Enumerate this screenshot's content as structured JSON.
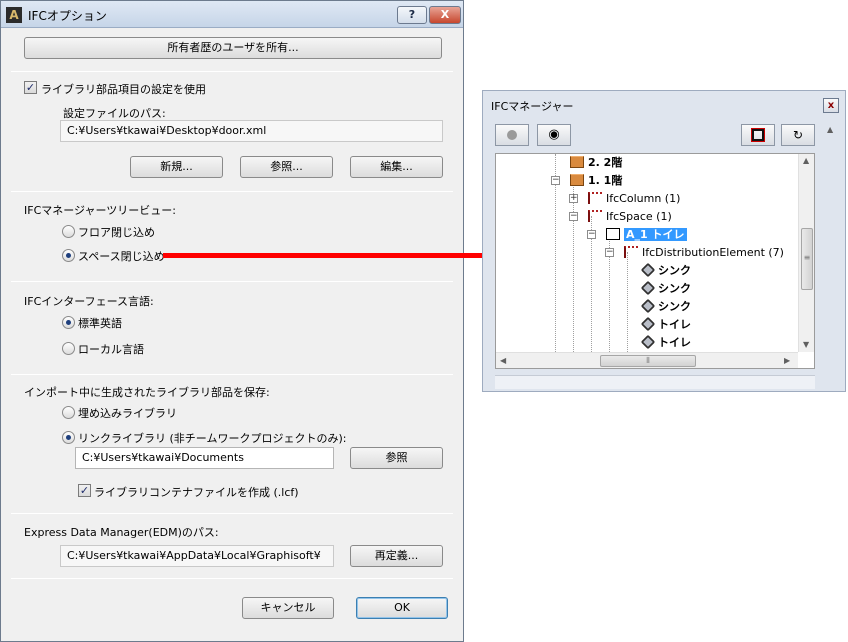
{
  "dialog": {
    "title": "IFCオプション",
    "help_label": "?",
    "close_label": "X",
    "owner_button": "所有者歴のユーザを所有...",
    "library": {
      "checkbox_label": "ライブラリ部品項目の設定を使用",
      "checked": true,
      "path_label": "設定ファイルのパス:",
      "path_value": "C:¥Users¥tkawai¥Desktop¥door.xml",
      "new_button": "新規...",
      "browse_button": "参照...",
      "edit_button": "編集..."
    },
    "tree_view": {
      "label": "IFCマネージャーツリービュー:",
      "options": [
        "フロア閉じ込め",
        "スペース閉じ込め"
      ],
      "selected": "スペース閉じ込め"
    },
    "language": {
      "label": "IFCインターフェース言語:",
      "options": [
        "標準英語",
        "ローカル言語"
      ],
      "selected": "標準英語"
    },
    "import_save": {
      "label": "インポート中に生成されたライブラリ部品を保存:",
      "options": [
        "埋め込みライブラリ",
        "リンクライブラリ (非チームワークプロジェクトのみ):"
      ],
      "selected": "リンクライブラリ (非チームワークプロジェクトのみ):",
      "path_value": "C:¥Users¥tkawai¥Documents",
      "browse_button": "参照",
      "container_label": "ライブラリコンテナファイルを作成 (.lcf)",
      "container_checked": true
    },
    "edm": {
      "label": "Express Data Manager(EDM)のパス:",
      "path_value": "C:¥Users¥tkawai¥AppData¥Local¥Graphisoft¥",
      "redefine_button": "再定義..."
    },
    "cancel_button": "キャンセル",
    "ok_button": "OK"
  },
  "ifc_manager": {
    "title": "IFCマネージャー",
    "close_label": "x",
    "tree": [
      {
        "label": "2. 2階"
      },
      {
        "label": "1. 1階"
      },
      {
        "label": "IfcColumn (1)"
      },
      {
        "label": "IfcSpace (1)"
      },
      {
        "label": "A_1 トイレ"
      },
      {
        "label": "IfcDistributionElement (7)"
      },
      {
        "label": "シンク"
      },
      {
        "label": "シンク"
      },
      {
        "label": "シンク"
      },
      {
        "label": "トイレ"
      },
      {
        "label": "トイレ"
      }
    ]
  },
  "colors": {
    "arrow": "#ff0000",
    "selection": "#3399ff"
  }
}
